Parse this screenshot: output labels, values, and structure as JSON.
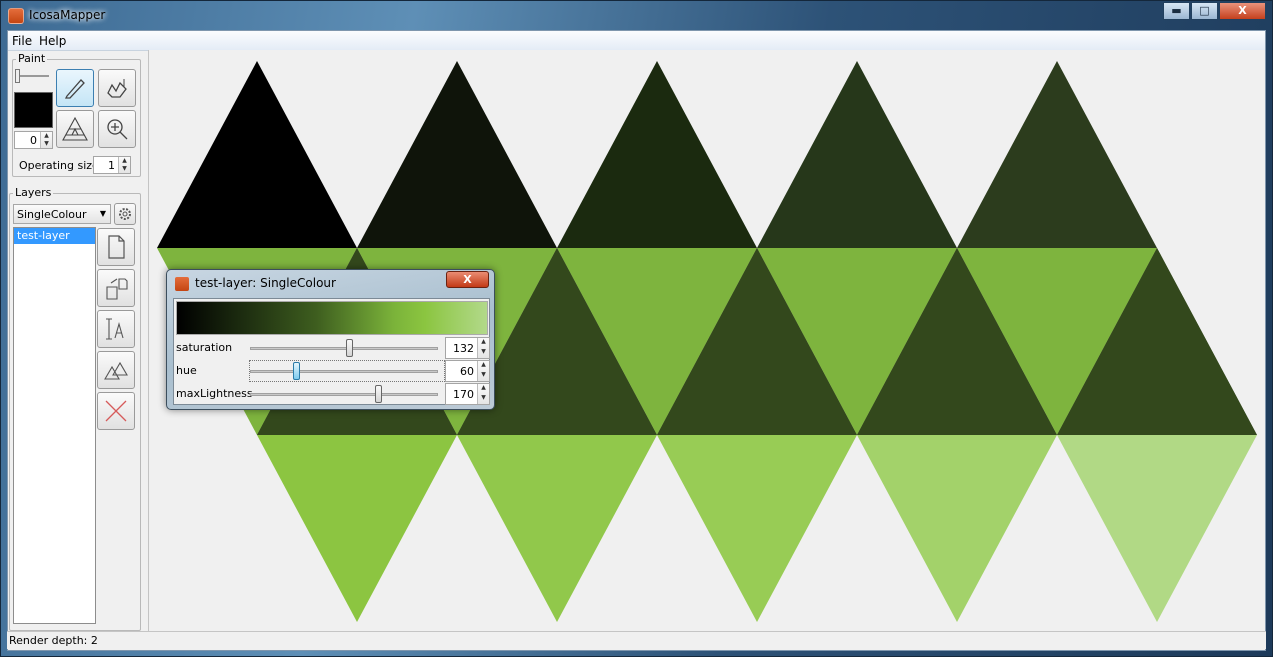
{
  "window": {
    "title": "IcosaMapper",
    "controls": {
      "minimize": "▬",
      "maximize": "□",
      "close": "X"
    }
  },
  "menu": {
    "file": "File",
    "help": "Help"
  },
  "paint": {
    "title": "Paint",
    "color_index": "0",
    "operating_size_label": "Operating size",
    "operating_size_value": "1",
    "tools": [
      "pencil-icon",
      "fill-icon",
      "triangle-grid-icon",
      "zoom-icon"
    ]
  },
  "layers": {
    "title": "Layers",
    "type_selected": "SingleColour",
    "items": [
      "test-layer"
    ],
    "buttons": [
      "new-layer-icon",
      "export-layer-icon",
      "rename-layer-icon",
      "duplicate-layer-icon",
      "delete-layer-icon"
    ]
  },
  "status": {
    "text": "Render depth: 2"
  },
  "dialog": {
    "title": "test-layer: SingleColour",
    "close": "X",
    "params": [
      {
        "name": "saturation",
        "value": "132"
      },
      {
        "name": "hue",
        "value": "60"
      },
      {
        "name": "maxLightness",
        "value": "170"
      }
    ]
  },
  "colors": {
    "triangle_top": [
      "#000000",
      "#0f140a",
      "#1b2a0f",
      "#26371a",
      "#2c3c1d"
    ],
    "band_light": "#7eb43e",
    "band_dark": "#33481c",
    "bottom": [
      "#8cc541",
      "#91c84b",
      "#98cc55",
      "#a3d26a",
      "#b1d985"
    ]
  }
}
